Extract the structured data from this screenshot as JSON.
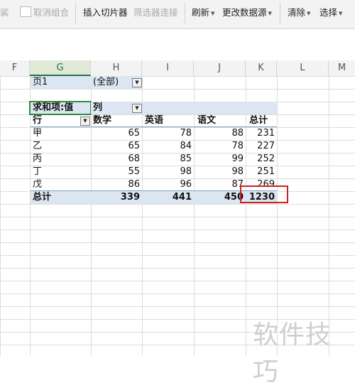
{
  "ribbon": {
    "partial_left": "裟",
    "ungroup": "取消组合",
    "insert_slicer": "插入切片器",
    "filter_connections": "筛选器连接",
    "refresh": "刷新",
    "change_source": "更改数据源",
    "clear": "清除",
    "select": "选择"
  },
  "columns": [
    "F",
    "G",
    "H",
    "I",
    "J",
    "K",
    "L",
    "M"
  ],
  "selected_column": "G",
  "pivot": {
    "page_label": "页1",
    "page_value": "(全部)",
    "value_header": "求和项:值",
    "col_label": "列",
    "row_label": "行",
    "col_headers": [
      "数学",
      "英语",
      "语文",
      "总计"
    ],
    "rows": [
      {
        "name": "甲",
        "values": [
          "65",
          "78",
          "88",
          "231"
        ]
      },
      {
        "name": "乙",
        "values": [
          "65",
          "84",
          "78",
          "227"
        ]
      },
      {
        "name": "丙",
        "values": [
          "68",
          "85",
          "99",
          "252"
        ]
      },
      {
        "name": "丁",
        "values": [
          "55",
          "98",
          "98",
          "251"
        ]
      },
      {
        "name": "戊",
        "values": [
          "86",
          "96",
          "87",
          "269"
        ]
      }
    ],
    "total_label": "总计",
    "totals": [
      "339",
      "441",
      "450",
      "1230"
    ]
  },
  "watermark": "软件技巧",
  "colors": {
    "accent_green": "#2e8b3e",
    "highlight_red": "#d11f1f",
    "pivot_blue": "#dce6f2"
  }
}
